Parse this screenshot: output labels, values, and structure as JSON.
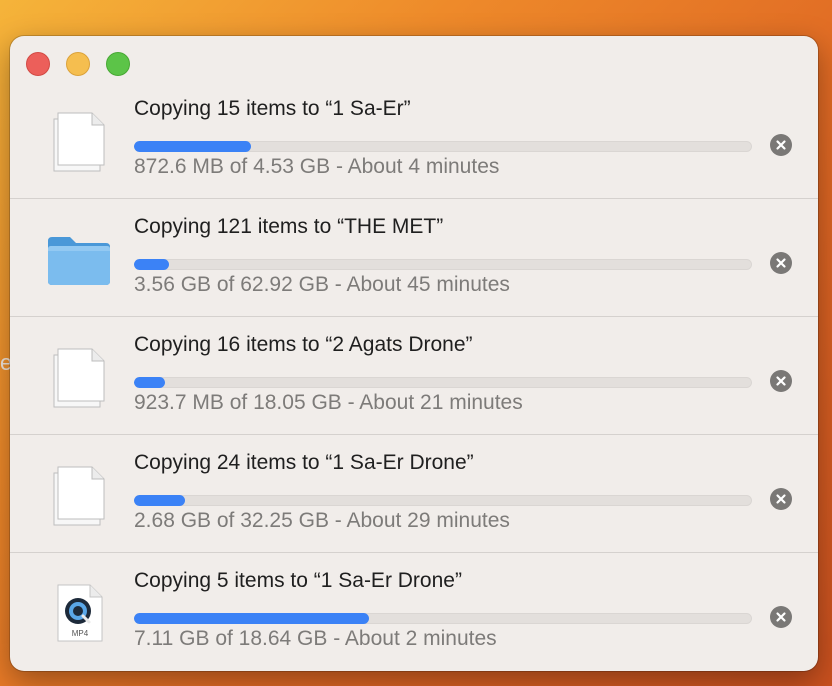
{
  "window": {
    "controls": {
      "close": "close",
      "minimize": "minimize",
      "zoom": "zoom"
    }
  },
  "desktop": {
    "edge_glyph": "e"
  },
  "copies": [
    {
      "title": "Copying 15 items to “1 Sa-Er”",
      "status": "872.6 MB of 4.53 GB - About 4 minutes",
      "progress": 0.19,
      "icon": "document-stack-icon"
    },
    {
      "title": "Copying 121 items to “THE MET”",
      "status": "3.56 GB of 62.92 GB - About 45 minutes",
      "progress": 0.057,
      "icon": "folder-icon"
    },
    {
      "title": "Copying 16 items to “2 Agats Drone”",
      "status": "923.7 MB of 18.05 GB - About 21 minutes",
      "progress": 0.05,
      "icon": "document-stack-icon"
    },
    {
      "title": "Copying 24 items to “1 Sa-Er Drone”",
      "status": "2.68 GB of 32.25 GB - About 29 minutes",
      "progress": 0.083,
      "icon": "document-stack-icon"
    },
    {
      "title": "Copying 5 items to “1 Sa-Er Drone”",
      "status": "7.11 GB of 18.64 GB - About 2 minutes",
      "progress": 0.381,
      "icon": "mp4-file-icon",
      "icon_label": "MP4"
    }
  ],
  "colors": {
    "progress_fill": "#3b82f6",
    "progress_track": "#e3dfdc",
    "stop_button": "#7a7876",
    "folder": "#5aa9e6"
  }
}
